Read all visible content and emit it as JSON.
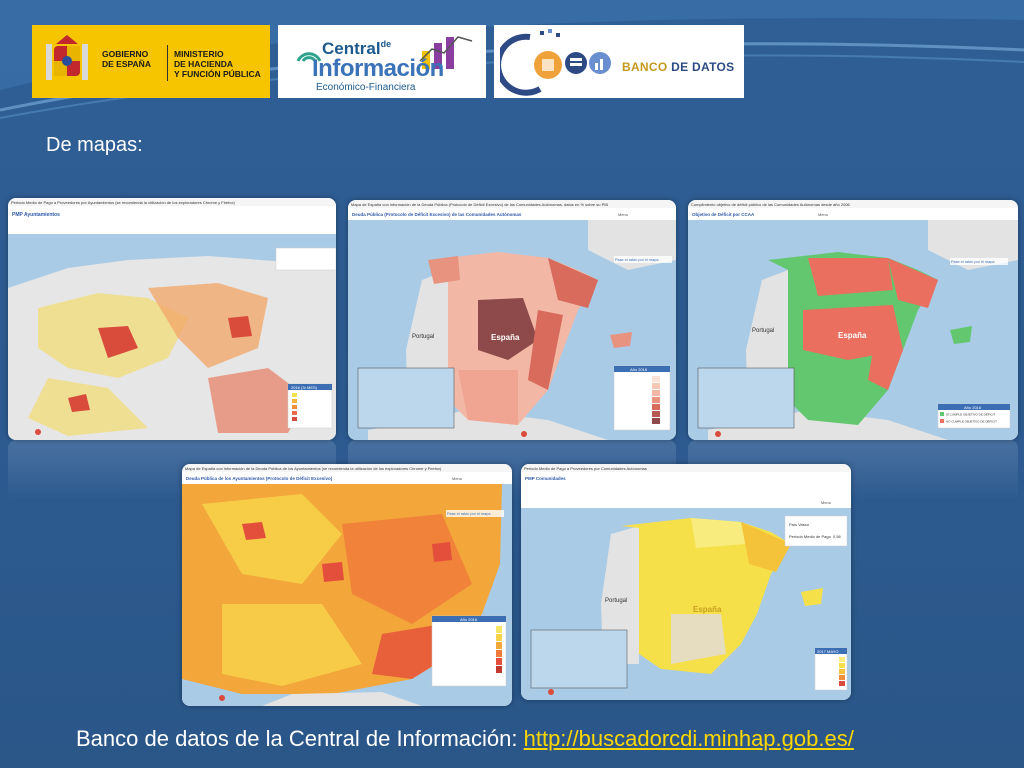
{
  "logos": {
    "gobierno_line1": "GOBIERNO",
    "gobierno_line2": "DE ESPAÑA",
    "ministerio_line1": "MINISTERIO",
    "ministerio_line2": "DE HACIENDA",
    "ministerio_line3": "Y FUNCIÓN PÚBLICA",
    "central_word": "Central",
    "central_de": "de",
    "informacion_word": "Información",
    "central_subtitle": "Económico-Financiera",
    "banco_word": "BANCO",
    "de_datos_word": "DE DATOS"
  },
  "heading": "De mapas:",
  "maps": [
    {
      "id": "pmp-ayuntamientos",
      "header": "Periodo Medio de Pago a Proveedores por Ayuntamientos (se recomienda la utilización de los exploradores Chrome y Firefox)",
      "tab": "PMP Ayuntamientos",
      "legend_title": "2016 (3r MES)",
      "menu": "Menu"
    },
    {
      "id": "deuda-ccaa",
      "header": "Mapa de España con información de la Deuda Pública (Protocolo de Déficit Excesivo) de las Comunidades Autónomas, datos en % sobre su PIB",
      "tab": "Deuda Pública (Protocolo de Déficit Excesivo) de las Comunidades Autónomas",
      "legend_title": "Año 2016",
      "menu": "Menu",
      "country_label": "España",
      "neighbor_label": "Portugal",
      "hover": "Pase el ratón por el mapa"
    },
    {
      "id": "deficit-ccaa",
      "header": "Cumplimiento objetivo de déficit público de las Comunidades Autónomas desde año 2006",
      "tab": "Objetivo de Déficit por CCAA",
      "legend_title": "Año 2016",
      "legend_items": [
        "SÍ CUMPLE OBJETIVO DE DÉFICIT",
        "NO CUMPLE OBJETIVO DE DÉFICIT"
      ],
      "menu": "Menu",
      "country_label": "España",
      "neighbor_label": "Portugal",
      "hover": "Pase el ratón por el mapa"
    },
    {
      "id": "deuda-ayuntamientos",
      "header": "Mapa de España con información de la Deuda Pública de los Ayuntamientos (se recomienda la utilización de los exploradores Chrome y Firefox)",
      "tab": "Deuda Pública de los Ayuntamientos (Protocolo de Déficit Excesivo)",
      "legend_title": "Año 2016",
      "menu": "Menu",
      "hover": "Pase el ratón por el mapa"
    },
    {
      "id": "pmp-ccaa",
      "header": "Periodo Medio de Pago a Proveedores por Comunidades Autónomas",
      "tab": "PMP Comunidades",
      "legend_title": "2017 MAYO",
      "menu": "Menu",
      "country_label": "España",
      "neighbor_label": "Portugal",
      "info_label1": "País Vasco",
      "info_label2": "Periodo Medio de Pago",
      "info_value": "0,56"
    }
  ],
  "footer": {
    "text": "Banco de datos de la Central de Información: ",
    "link": "http://buscadorcdi.minhap.gob.es/"
  },
  "colors": {
    "background": "#2d5b91",
    "link": "#ffd700",
    "gobierno_yellow": "#f6c500",
    "sea": "#a9cbe6",
    "land_grey": "#e3e3e3",
    "debt_dark": "#8e4a4a",
    "debt_light": "#f3b7a6",
    "deficit_ok": "#63c76f",
    "deficit_no": "#ea6f5f",
    "pmp_yellow": "#f5e04a"
  }
}
